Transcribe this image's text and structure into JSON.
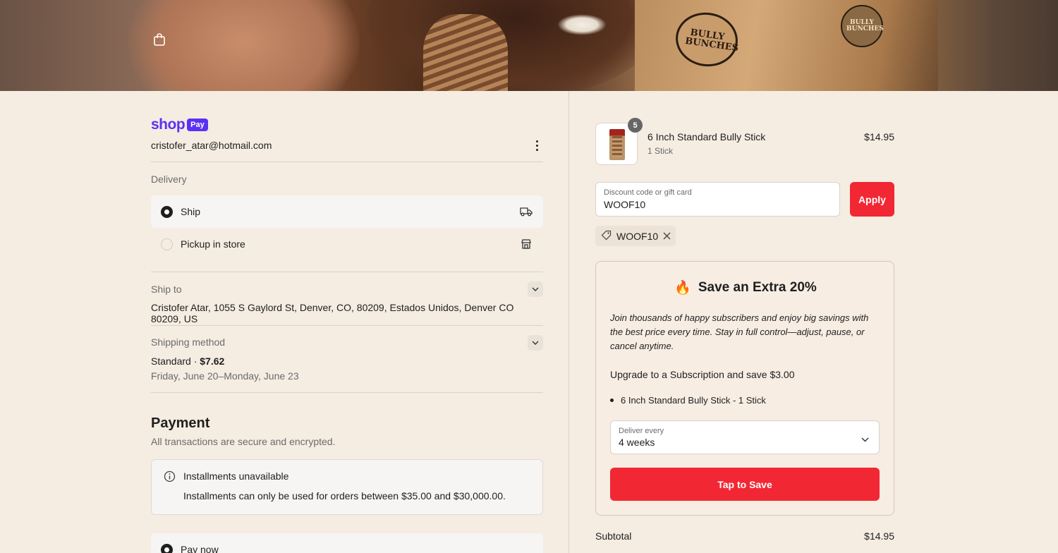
{
  "hero": {
    "logo_left": "BULLY BUNCHES",
    "logo_right": "BULLY BUNCHES"
  },
  "account": {
    "shop_brand": "shop",
    "pay_badge": "Pay",
    "email": "cristofer_atar@hotmail.com"
  },
  "delivery": {
    "heading": "Delivery",
    "options": [
      {
        "label": "Ship",
        "selected": true,
        "icon": "truck-icon"
      },
      {
        "label": "Pickup in store",
        "selected": false,
        "icon": "store-icon"
      }
    ]
  },
  "ship_to": {
    "label": "Ship to",
    "address": "Cristofer Atar, 1055 S Gaylord St, Denver, CO, 80209, Estados Unidos, Denver CO 80209, US"
  },
  "shipping_method": {
    "label": "Shipping method",
    "name": "Standard · ",
    "price": "$7.62",
    "dates": "Friday, June 20–Monday, June 23"
  },
  "payment": {
    "heading": "Payment",
    "subtitle": "All transactions are secure and encrypted.",
    "installments_title": "Installments unavailable",
    "installments_desc": "Installments can only be used for orders between $35.00 and $30,000.00.",
    "pay_now_label": "Pay now"
  },
  "order": {
    "item": {
      "name": "6 Inch Standard Bully Stick",
      "variant": "1 Stick",
      "price": "$14.95",
      "quantity": "5"
    },
    "discount_placeholder": "Discount code or gift card",
    "discount_value": "WOOF10",
    "apply_label": "Apply",
    "applied_code": "WOOF10"
  },
  "promo": {
    "emoji": "🔥",
    "title": "Save an Extra 20%",
    "body": "Join thousands of happy subscribers and enjoy big savings with the best price every time. Stay in full control—adjust, pause, or cancel anytime.",
    "upsell": "Upgrade to a Subscription and save $3.00",
    "bullet": "6 Inch Standard Bully Stick - 1 Stick",
    "deliver_label": "Deliver every",
    "deliver_value": "4 weeks",
    "cta": "Tap to Save"
  },
  "summary": {
    "subtotal_label": "Subtotal",
    "subtotal_value": "$14.95"
  },
  "colors": {
    "page_bg": "#f5ece2",
    "accent_red": "#f22734",
    "shop_purple": "#5a31f4"
  }
}
